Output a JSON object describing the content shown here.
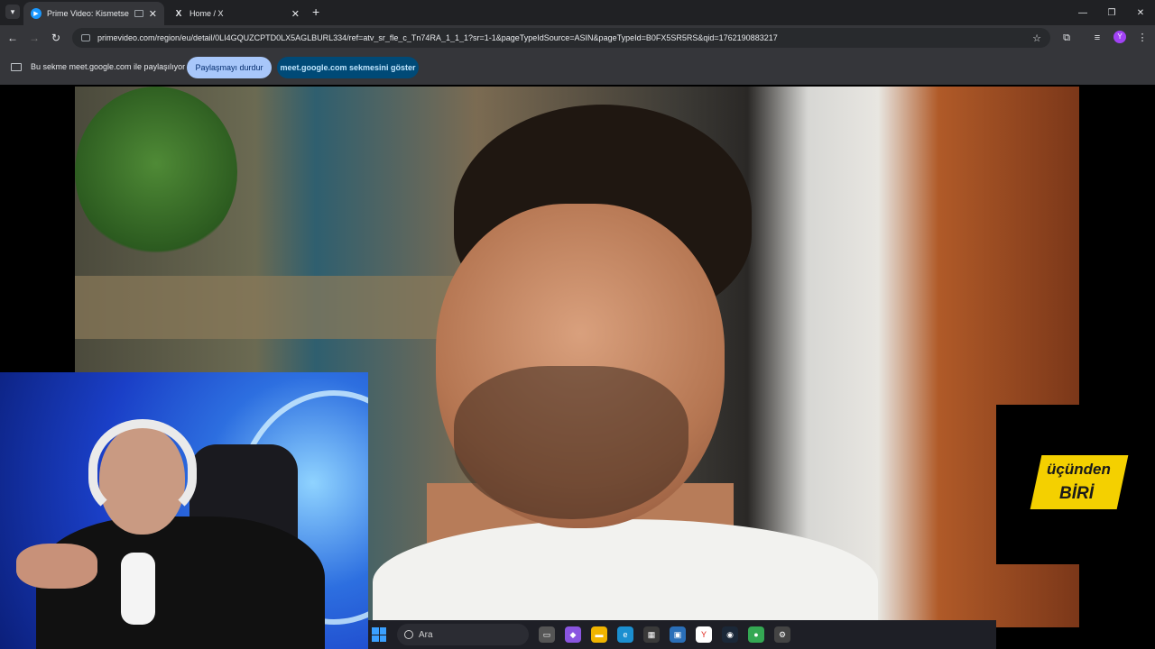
{
  "browser": {
    "tabs": [
      {
        "title": "Prime Video: Kismetse Olur",
        "favicon": "prime-video-icon",
        "active": true
      },
      {
        "title": "Home / X",
        "favicon": "x-logo-icon",
        "active": false
      }
    ],
    "url": "primevideo.com/region/eu/detail/0LI4GQUZCPTD0LX5AGLBURL334/ref=atv_sr_fle_c_Tn74RA_1_1_1?sr=1-1&pageTypeIdSource=ASIN&pageTypeId=B0FX5SR5RS&qid=1762190883217",
    "profile_initial": "Y"
  },
  "share_bar": {
    "message": "Bu sekme meet.google.com ile paylaşılıyor",
    "stop_button": "Paylaşmayı durdur",
    "show_tab_button": "meet.google.com sekmesini göster"
  },
  "overlay_logo": {
    "line1": "üçünden",
    "line2": "BİRİ",
    "color": "#f4d000"
  },
  "taskbar": {
    "search_placeholder": "Ara"
  },
  "colors": {
    "tabstrip_bg": "#202124",
    "toolbar_bg": "#35363a",
    "accent_blue": "#a8c7fa",
    "accent_dark_blue": "#004a77"
  }
}
